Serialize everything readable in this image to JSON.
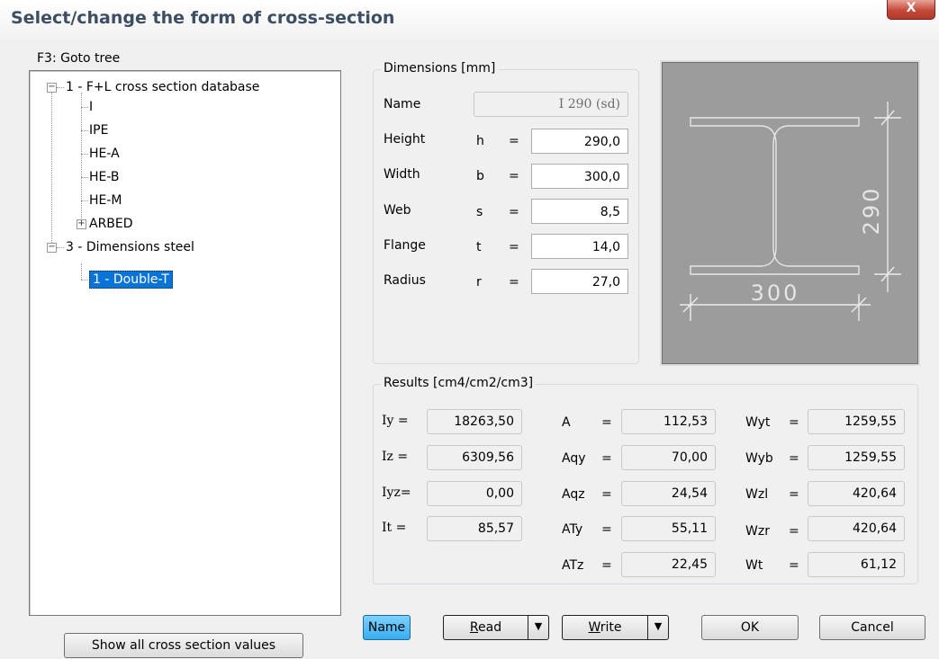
{
  "window": {
    "title": "Select/change the form of cross-section",
    "close_glyph": "X"
  },
  "tree": {
    "label": "F3: Goto tree",
    "root1": "1 - F+L cross section database",
    "children1": [
      "I",
      "IPE",
      "HE-A",
      "HE-B",
      "HE-M"
    ],
    "arbed": "ARBED",
    "root2": "3 - Dimensions steel",
    "selected": "1 - Double-T",
    "expanded_glyph": "−",
    "collapsed_glyph": "+"
  },
  "dimensions": {
    "title": "Dimensions  [mm]",
    "name_label": "Name",
    "name_value": "I 290 (sd)",
    "rows": [
      {
        "label": "Height",
        "sym": "h",
        "eq": "=",
        "value": "290,0"
      },
      {
        "label": "Width",
        "sym": "b",
        "eq": "=",
        "value": "300,0"
      },
      {
        "label": "Web",
        "sym": "s",
        "eq": "=",
        "value": "8,5"
      },
      {
        "label": "Flange",
        "sym": "t",
        "eq": "=",
        "value": "14,0"
      },
      {
        "label": "Radius",
        "sym": "r",
        "eq": "=",
        "value": "27,0"
      }
    ]
  },
  "preview": {
    "height_dim": "290",
    "width_dim": "300",
    "bg_color": "#9c9c9c",
    "line_color": "#e8e8e8"
  },
  "results": {
    "title": "Results  [cm4/cm2/cm3]",
    "col1": [
      {
        "label": "Iy  =",
        "value": "18263,50"
      },
      {
        "label": "Iz  =",
        "value": "6309,56"
      },
      {
        "label": "Iyz=",
        "value": "0,00"
      },
      {
        "label": "It  =",
        "value": "85,57"
      }
    ],
    "col2": [
      {
        "label": "A",
        "eq": "=",
        "value": "112,53"
      },
      {
        "label": "Aqy",
        "eq": "=",
        "value": "70,00"
      },
      {
        "label": "Aqz",
        "eq": "=",
        "value": "24,54"
      },
      {
        "label": "ATy",
        "eq": "=",
        "value": "55,11"
      },
      {
        "label": "ATz",
        "eq": "=",
        "value": "22,45"
      }
    ],
    "col3": [
      {
        "label": "Wyt",
        "eq": "=",
        "value": "1259,55"
      },
      {
        "label": "Wyb",
        "eq": "=",
        "value": "1259,55"
      },
      {
        "label": "Wzl",
        "eq": "=",
        "value": "420,64"
      },
      {
        "label": "Wzr",
        "eq": "=",
        "value": "420,64"
      },
      {
        "label": "Wt",
        "eq": "=",
        "value": "61,12"
      }
    ]
  },
  "buttons": {
    "show_all": "Show all cross section values",
    "name": "Name",
    "read_first": "R",
    "read_rest": "ead",
    "write_first": "W",
    "write_rest": "rite",
    "ok": "OK",
    "cancel": "Cancel",
    "dropdown_glyph": "▼"
  }
}
